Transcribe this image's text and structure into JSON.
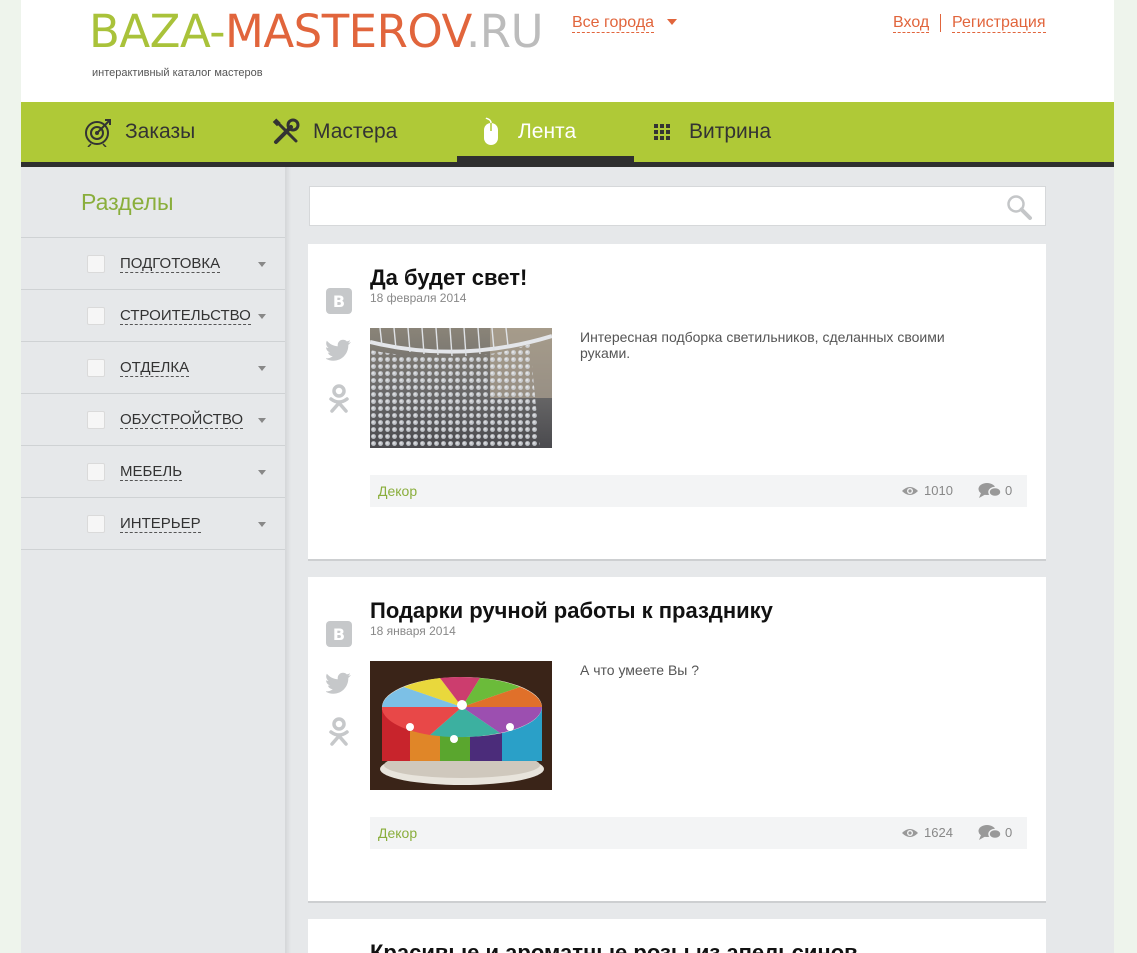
{
  "header": {
    "logo_part1": "BAZA-",
    "logo_part2": "MASTEROV",
    "logo_part3": ".RU",
    "tagline": "интерактивный каталог мастеров",
    "city_select": "Все города",
    "login": "Вход",
    "register": "Регистрация"
  },
  "nav": {
    "items": [
      {
        "label": "Заказы",
        "icon": "target-icon"
      },
      {
        "label": "Мастера",
        "icon": "tools-icon"
      },
      {
        "label": "Лента",
        "icon": "mouse-icon",
        "active": true
      },
      {
        "label": "Витрина",
        "icon": "grid-icon"
      }
    ]
  },
  "sidebar": {
    "title": "Разделы",
    "items": [
      {
        "label": "ПОДГОТОВКА"
      },
      {
        "label": "СТРОИТЕЛЬСТВО"
      },
      {
        "label": "ОТДЕЛКА"
      },
      {
        "label": "ОБУСТРОЙСТВО"
      },
      {
        "label": "МЕБЕЛЬ"
      },
      {
        "label": "ИНТЕРЬЕР"
      }
    ]
  },
  "search": {
    "placeholder": "",
    "icon": "search-icon"
  },
  "share_icons": [
    "vk-icon",
    "twitter-icon",
    "odnoklassniki-icon"
  ],
  "posts": [
    {
      "title": "Да будет свет!",
      "date": "18 февраля 2014",
      "text": "Интересная подборка светильников, сделанных своими руками.",
      "category": "Декор",
      "views": "1010",
      "comments": "0"
    },
    {
      "title": "Подарки ручной работы к празднику",
      "date": "18 января 2014",
      "text": "А что умеете Вы ?",
      "category": "Декор",
      "views": "1624",
      "comments": "0"
    },
    {
      "title": "Красивые и ароматные розы из апельсинов"
    }
  ],
  "colors": {
    "accent_green": "#afc937",
    "logo_orange": "#e1653c",
    "dark_bar": "#2f2f2f"
  }
}
